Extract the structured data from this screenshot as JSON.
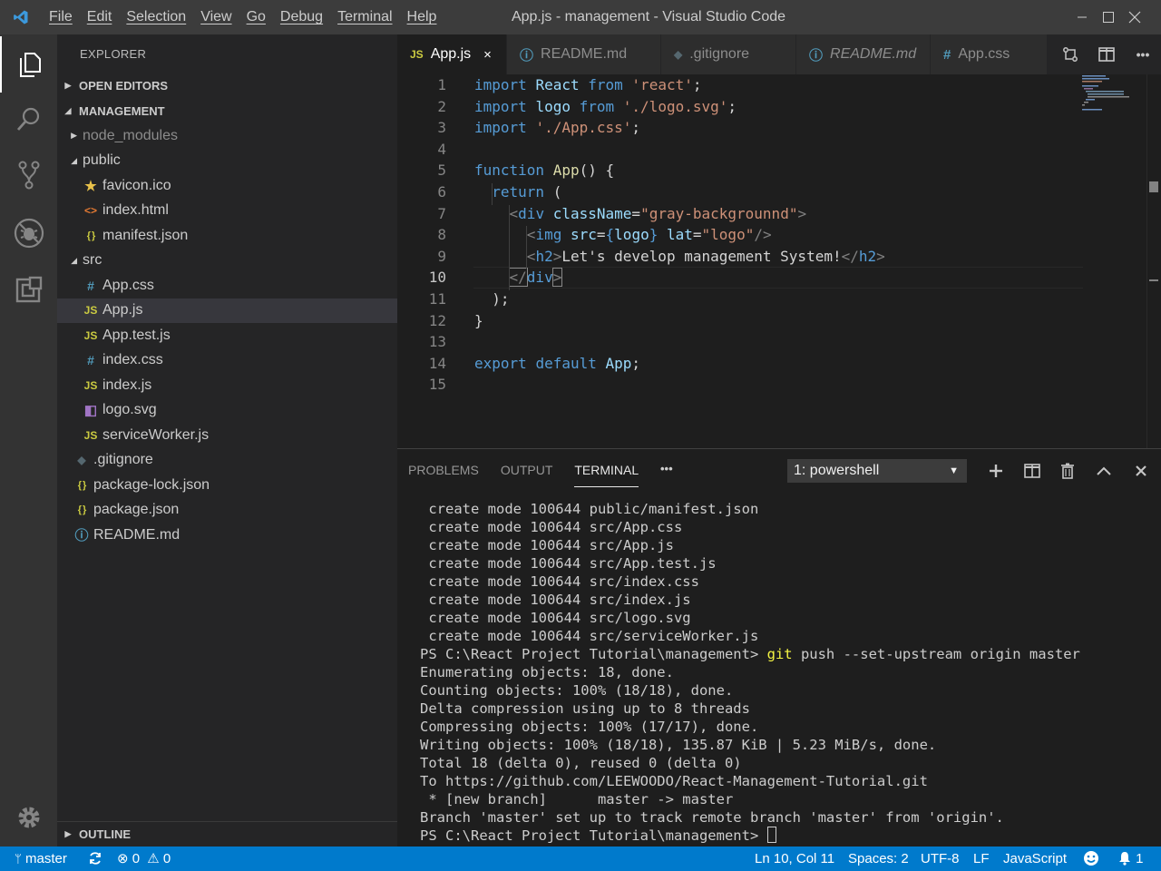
{
  "window": {
    "title": "App.js - management - Visual Studio Code",
    "menu": [
      "File",
      "Edit",
      "Selection",
      "View",
      "Go",
      "Debug",
      "Terminal",
      "Help"
    ]
  },
  "sidebar": {
    "title": "EXPLORER",
    "open_editors": "OPEN EDITORS",
    "project": "MANAGEMENT",
    "outline": "OUTLINE",
    "tree": [
      {
        "label": "node_modules",
        "type": "folder",
        "state": "collapsed",
        "indent": 1
      },
      {
        "label": "public",
        "type": "folder",
        "state": "expanded",
        "indent": 1
      },
      {
        "label": "favicon.ico",
        "type": "file",
        "icon": "star",
        "indent": 2
      },
      {
        "label": "index.html",
        "type": "file",
        "icon": "html",
        "indent": 2
      },
      {
        "label": "manifest.json",
        "type": "file",
        "icon": "json",
        "indent": 2
      },
      {
        "label": "src",
        "type": "folder",
        "state": "expanded",
        "indent": 1
      },
      {
        "label": "App.css",
        "type": "file",
        "icon": "css",
        "indent": 2
      },
      {
        "label": "App.js",
        "type": "file",
        "icon": "js",
        "indent": 2,
        "selected": true
      },
      {
        "label": "App.test.js",
        "type": "file",
        "icon": "js",
        "indent": 2
      },
      {
        "label": "index.css",
        "type": "file",
        "icon": "css",
        "indent": 2
      },
      {
        "label": "index.js",
        "type": "file",
        "icon": "js",
        "indent": 2
      },
      {
        "label": "logo.svg",
        "type": "file",
        "icon": "svg",
        "indent": 2
      },
      {
        "label": "serviceWorker.js",
        "type": "file",
        "icon": "js",
        "indent": 2
      },
      {
        "label": ".gitignore",
        "type": "file",
        "icon": "git",
        "indent": 1
      },
      {
        "label": "package-lock.json",
        "type": "file",
        "icon": "json",
        "indent": 1
      },
      {
        "label": "package.json",
        "type": "file",
        "icon": "json",
        "indent": 1
      },
      {
        "label": "README.md",
        "type": "file",
        "icon": "info",
        "indent": 1
      }
    ]
  },
  "tabs": [
    {
      "label": "App.js",
      "icon_text": "JS",
      "active": true,
      "close": "×"
    },
    {
      "label": "README.md",
      "icon_text": "ⓘ"
    },
    {
      "label": ".gitignore",
      "icon_text": "◆"
    },
    {
      "label": "README.md",
      "icon_text": "ⓘ",
      "italic": true
    },
    {
      "label": "App.css",
      "icon_text": "#"
    }
  ],
  "editor": {
    "current_line": 10,
    "line_numbers": [
      "1",
      "2",
      "3",
      "4",
      "5",
      "6",
      "7",
      "8",
      "9",
      "10",
      "11",
      "12",
      "13",
      "14",
      "15"
    ],
    "lines": [
      [
        [
          "k",
          "import"
        ],
        [
          "t",
          " "
        ],
        [
          "v",
          "React"
        ],
        [
          "t",
          " "
        ],
        [
          "k",
          "from"
        ],
        [
          "t",
          " "
        ],
        [
          "s",
          "'react'"
        ],
        [
          "t",
          ";"
        ]
      ],
      [
        [
          "k",
          "import"
        ],
        [
          "t",
          " "
        ],
        [
          "v",
          "logo"
        ],
        [
          "t",
          " "
        ],
        [
          "k",
          "from"
        ],
        [
          "t",
          " "
        ],
        [
          "s",
          "'./logo.svg'"
        ],
        [
          "t",
          ";"
        ]
      ],
      [
        [
          "k",
          "import"
        ],
        [
          "t",
          " "
        ],
        [
          "s",
          "'./App.css'"
        ],
        [
          "t",
          ";"
        ]
      ],
      [],
      [
        [
          "k",
          "function"
        ],
        [
          "t",
          " "
        ],
        [
          "f",
          "App"
        ],
        [
          "t",
          "() {"
        ]
      ],
      [
        [
          "t",
          "  "
        ],
        [
          "k",
          "return"
        ],
        [
          "t",
          " ("
        ]
      ],
      [
        [
          "t",
          "    "
        ],
        [
          "br",
          "<"
        ],
        [
          "tg",
          "div"
        ],
        [
          "t",
          " "
        ],
        [
          "at",
          "className"
        ],
        [
          "t",
          "="
        ],
        [
          "s",
          "\"gray-backgrounnd\""
        ],
        [
          "br",
          ">"
        ]
      ],
      [
        [
          "t",
          "      "
        ],
        [
          "br",
          "<"
        ],
        [
          "tg",
          "img"
        ],
        [
          "t",
          " "
        ],
        [
          "at",
          "src"
        ],
        [
          "t",
          "="
        ],
        [
          "k",
          "{"
        ],
        [
          "v",
          "logo"
        ],
        [
          "k",
          "}"
        ],
        [
          "t",
          " "
        ],
        [
          "at",
          "lat"
        ],
        [
          "t",
          "="
        ],
        [
          "s",
          "\"logo\""
        ],
        [
          "br",
          "/>"
        ]
      ],
      [
        [
          "t",
          "      "
        ],
        [
          "br",
          "<"
        ],
        [
          "tg",
          "h2"
        ],
        [
          "br",
          ">"
        ],
        [
          "t",
          "Let's develop management System!"
        ],
        [
          "br",
          "</"
        ],
        [
          "tg",
          "h2"
        ],
        [
          "br",
          ">"
        ]
      ],
      [
        [
          "t",
          "    "
        ],
        [
          "br",
          "</"
        ],
        [
          "tg",
          "div"
        ],
        [
          "br",
          ">"
        ]
      ],
      [
        [
          "t",
          "  );"
        ]
      ],
      [
        [
          "t",
          "}"
        ]
      ],
      [],
      [
        [
          "k",
          "export"
        ],
        [
          "t",
          " "
        ],
        [
          "k",
          "default"
        ],
        [
          "t",
          " "
        ],
        [
          "v",
          "App"
        ],
        [
          "t",
          ";"
        ]
      ],
      []
    ]
  },
  "panel": {
    "tabs": [
      "PROBLEMS",
      "OUTPUT",
      "TERMINAL"
    ],
    "active_tab": "TERMINAL",
    "more": "•••",
    "terminal_select": "1: powershell",
    "terminal_lines": [
      " create mode 100644 public/manifest.json",
      " create mode 100644 src/App.css",
      " create mode 100644 src/App.js",
      " create mode 100644 src/App.test.js",
      " create mode 100644 src/index.css",
      " create mode 100644 src/index.js",
      " create mode 100644 src/logo.svg",
      " create mode 100644 src/serviceWorker.js",
      "PS C:\\React Project Tutorial\\management> |git| push --set-upstream origin master",
      "Enumerating objects: 18, done.",
      "Counting objects: 100% (18/18), done.",
      "Delta compression using up to 8 threads",
      "Compressing objects: 100% (17/17), done.",
      "Writing objects: 100% (18/18), 135.87 KiB | 5.23 MiB/s, done.",
      "Total 18 (delta 0), reused 0 (delta 0)",
      "To https://github.com/LEEWOODO/React-Management-Tutorial.git",
      " * [new branch]      master -> master",
      "Branch 'master' set up to track remote branch 'master' from 'origin'.",
      "PS C:\\React Project Tutorial\\management> "
    ]
  },
  "statusbar": {
    "branch": "master",
    "errors": "0",
    "warnings": "0",
    "position": "Ln 10, Col 11",
    "spaces": "Spaces: 2",
    "encoding": "UTF-8",
    "eol": "LF",
    "language": "JavaScript",
    "notifications": "1"
  },
  "colors": {
    "accent": "#007acc",
    "titlebar": "#3c3c3c",
    "activitybar": "#333333",
    "sidebar": "#252526",
    "editor": "#1e1e1e"
  }
}
